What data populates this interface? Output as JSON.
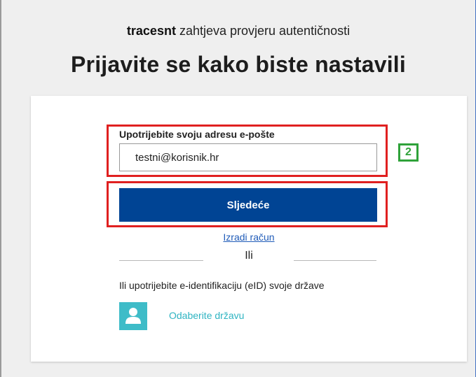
{
  "header": {
    "app_name": "tracesnt",
    "auth_request": "zahtjeva provjeru autentičnosti",
    "title": "Prijavite se kako biste nastavili"
  },
  "login": {
    "email_label": "Upotrijebite svoju adresu e-pošte",
    "email_value": "testni@korisnik.hr",
    "next_label": "Sljedeće",
    "create_account_label": "Izradi račun",
    "or_label": "Ili",
    "eid_label": "Ili upotrijebite e-identifikaciju (eID) svoje države",
    "choose_country_label": "Odaberite državu"
  },
  "annotation": {
    "step_number": "2"
  },
  "colors": {
    "primary_button": "#004494",
    "highlight_box": "#e02020",
    "step_badge": "#2fa23a",
    "eid_accent": "#3ebcc8"
  },
  "icons": {
    "eid": "user-icon"
  }
}
